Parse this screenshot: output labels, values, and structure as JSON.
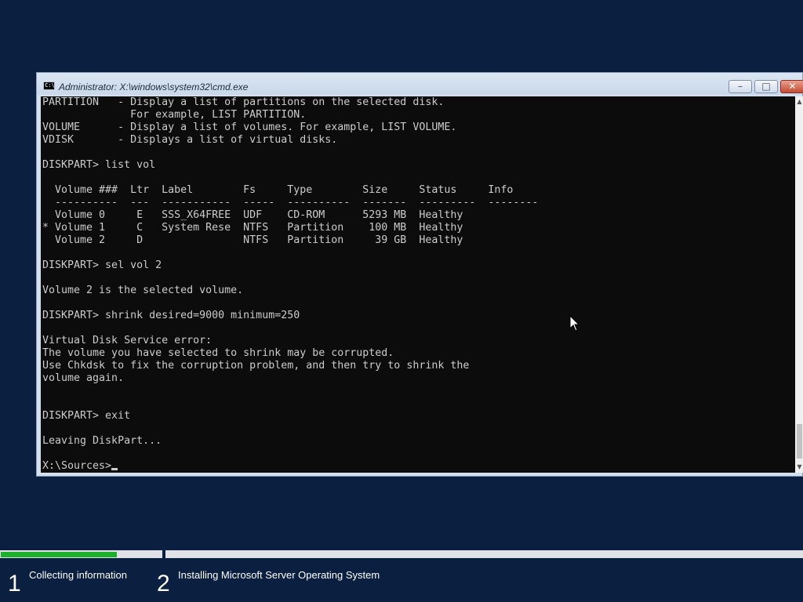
{
  "window": {
    "title": "Administrator: X:\\windows\\system32\\cmd.exe",
    "icon_text": "C:\\",
    "controls": {
      "minimize": "icon-minimize",
      "maximize": "icon-maximize",
      "close": "icon-close"
    }
  },
  "console": {
    "lines": [
      "PARTITION   - Display a list of partitions on the selected disk.",
      "              For example, LIST PARTITION.",
      "VOLUME      - Display a list of volumes. For example, LIST VOLUME.",
      "VDISK       - Displays a list of virtual disks.",
      "",
      "DISKPART> list vol",
      "",
      "  Volume ###  Ltr  Label        Fs     Type        Size     Status     Info",
      "  ----------  ---  -----------  -----  ----------  -------  ---------  --------",
      "  Volume 0     E   SSS_X64FREE  UDF    CD-ROM      5293 MB  Healthy",
      "* Volume 1     C   System Rese  NTFS   Partition    100 MB  Healthy",
      "  Volume 2     D                NTFS   Partition     39 GB  Healthy",
      "",
      "DISKPART> sel vol 2",
      "",
      "Volume 2 is the selected volume.",
      "",
      "DISKPART> shrink desired=9000 minimum=250",
      "",
      "Virtual Disk Service error:",
      "The volume you have selected to shrink may be corrupted.",
      "Use Chkdsk to fix the corruption problem, and then try to shrink the",
      "volume again.",
      "",
      "",
      "DISKPART> exit",
      "",
      "Leaving DiskPart...",
      ""
    ],
    "prompt": "X:\\Sources>"
  },
  "setup": {
    "steps": [
      {
        "number": "1",
        "label": "Collecting information",
        "progress": 0.72
      },
      {
        "number": "2",
        "label": "Installing Microsoft Server Operating System",
        "progress": 0
      }
    ],
    "progress_color": "#1db02b"
  }
}
